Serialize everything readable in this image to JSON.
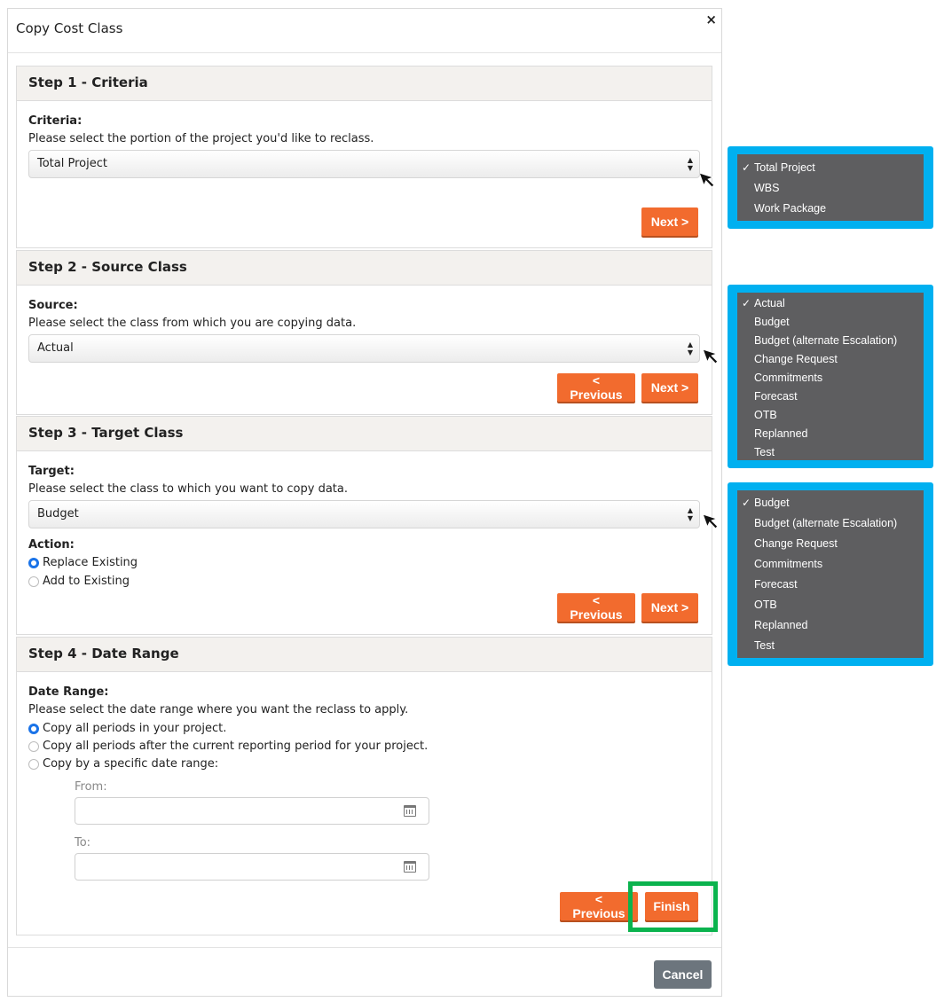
{
  "modal": {
    "title": "Copy Cost Class",
    "close_label": "×",
    "cancel_label": "Cancel"
  },
  "step1": {
    "title": "Step 1 - Criteria",
    "label": "Criteria:",
    "help": "Please select the portion of the project you'd like to reclass.",
    "selected": "Total Project",
    "next_label": "Next >"
  },
  "step2": {
    "title": "Step 2 - Source Class",
    "label": "Source:",
    "help": "Please select the class from which you are copying data.",
    "selected": "Actual",
    "previous_label": "< Previous",
    "next_label": "Next >"
  },
  "step3": {
    "title": "Step 3 - Target Class",
    "label": "Target:",
    "help": "Please select the class to which you want to copy data.",
    "selected": "Budget",
    "action_label": "Action:",
    "action_options": [
      "Replace Existing",
      "Add to Existing"
    ],
    "action_selected": "Replace Existing",
    "previous_label": "< Previous",
    "next_label": "Next >"
  },
  "step4": {
    "title": "Step 4 - Date Range",
    "label": "Date Range:",
    "help": "Please select the date range where you want the reclass to apply.",
    "options": [
      "Copy all periods in your project.",
      "Copy all periods after the current reporting period for your project.",
      "Copy by a specific date range:"
    ],
    "selected": "Copy all periods in your project.",
    "from_label": "From:",
    "to_label": "To:",
    "from_value": "",
    "to_value": "",
    "previous_label": "< Previous",
    "finish_label": "Finish"
  },
  "callouts": {
    "criteria_options": [
      "Total Project",
      "WBS",
      "Work Package"
    ],
    "criteria_checked": "Total Project",
    "source_options": [
      "Actual",
      "Budget",
      "Budget (alternate Escalation)",
      "Change Request",
      "Commitments",
      "Forecast",
      "OTB",
      "Replanned",
      "Test"
    ],
    "source_checked": "Actual",
    "target_options": [
      "Budget",
      "Budget (alternate Escalation)",
      "Change Request",
      "Commitments",
      "Forecast",
      "OTB",
      "Replanned",
      "Test"
    ],
    "target_checked": "Budget"
  },
  "colors": {
    "primary_button": "#f26b2e",
    "secondary_button": "#6c757d",
    "callout_border": "#00b0f0",
    "highlight": "#0bb34e",
    "dropdown_bg": "#5e5e60",
    "radio_checked": "#1a73e8"
  },
  "icons": {
    "close": "close-icon",
    "select_arrows": "select-arrows-icon",
    "calendar": "calendar-icon",
    "check": "check-icon",
    "pointer": "arrow-cursor-icon"
  }
}
